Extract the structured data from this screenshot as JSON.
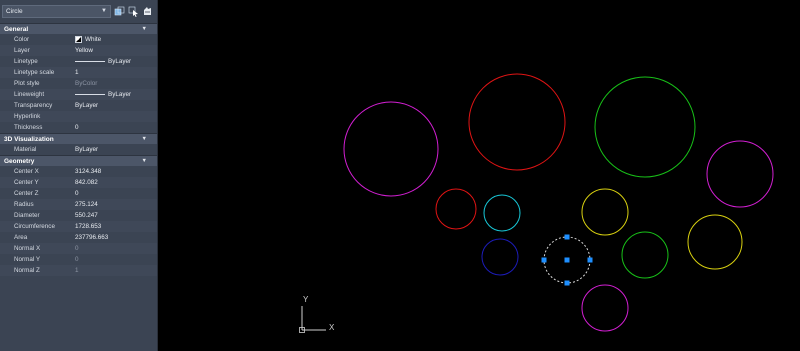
{
  "selection": {
    "value": "Circle"
  },
  "sections": {
    "general": {
      "title": "General",
      "rows": [
        {
          "label": "Color",
          "value": "White"
        },
        {
          "label": "Layer",
          "value": "Yellow"
        },
        {
          "label": "Linetype",
          "value": "ByLayer"
        },
        {
          "label": "Linetype scale",
          "value": "1"
        },
        {
          "label": "Plot style",
          "value": "ByColor"
        },
        {
          "label": "Lineweight",
          "value": "ByLayer"
        },
        {
          "label": "Transparency",
          "value": "ByLayer"
        },
        {
          "label": "Hyperlink",
          "value": ""
        },
        {
          "label": "Thickness",
          "value": "0"
        }
      ]
    },
    "visualization": {
      "title": "3D Visualization",
      "rows": [
        {
          "label": "Material",
          "value": "ByLayer"
        }
      ]
    },
    "geometry": {
      "title": "Geometry",
      "rows": [
        {
          "label": "Center X",
          "value": "3124.348"
        },
        {
          "label": "Center Y",
          "value": "842.082"
        },
        {
          "label": "Center Z",
          "value": "0"
        },
        {
          "label": "Radius",
          "value": "275.124"
        },
        {
          "label": "Diameter",
          "value": "550.247"
        },
        {
          "label": "Circumference",
          "value": "1728.653"
        },
        {
          "label": "Area",
          "value": "237796.663"
        },
        {
          "label": "Normal X",
          "value": "0"
        },
        {
          "label": "Normal Y",
          "value": "0"
        },
        {
          "label": "Normal Z",
          "value": "1"
        }
      ]
    }
  },
  "ucs": {
    "x_label": "X",
    "y_label": "Y"
  },
  "colors": {
    "magenta": "#d21fd2",
    "red": "#e01414",
    "green": "#18c018",
    "cyan": "#18c8d8",
    "blue": "#1c1cb8",
    "yellow": "#d8d010",
    "selected": "#d8d8d8",
    "grip": "#1e8fff"
  }
}
